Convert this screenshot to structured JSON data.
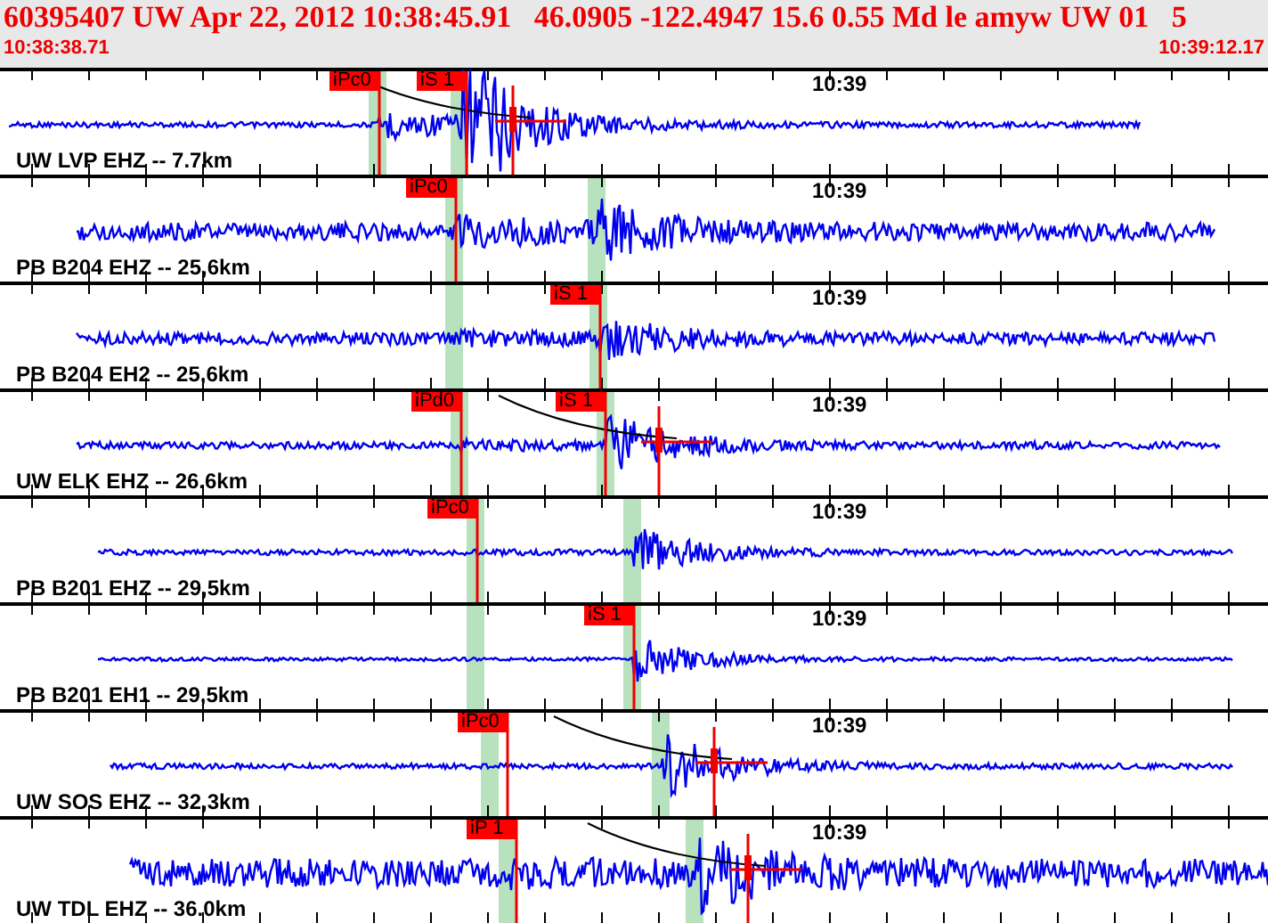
{
  "header": {
    "title": "60395407 UW Apr 22, 2012 10:38:45.91   46.0905 -122.4947 15.6 0.55 Md le amyw UW 01   5",
    "start_time": "10:38:38.71",
    "end_time": "10:39:12.17"
  },
  "traces": [
    {
      "station": "UW LVP EHZ -- 7.7km",
      "time_label": "10:39",
      "picks": [
        {
          "label": "iPc0"
        },
        {
          "label": "iS 1"
        }
      ]
    },
    {
      "station": "PB B204 EHZ -- 25,6km",
      "time_label": "10:39",
      "picks": [
        {
          "label": "iPc0"
        }
      ]
    },
    {
      "station": "PB B204 EH2 -- 25,6km",
      "time_label": "10:39",
      "picks": [
        {
          "label": "iS 1"
        }
      ]
    },
    {
      "station": "UW ELK EHZ -- 26.6km",
      "time_label": "10:39",
      "picks": [
        {
          "label": "iPd0"
        },
        {
          "label": "iS 1"
        }
      ]
    },
    {
      "station": "PB B201 EHZ -- 29,5km",
      "time_label": "10:39",
      "picks": [
        {
          "label": "iPc0"
        }
      ]
    },
    {
      "station": "PB B201 EH1 -- 29,5km",
      "time_label": "10:39",
      "picks": [
        {
          "label": "iS 1"
        }
      ]
    },
    {
      "station": "UW SOS EHZ -- 32,3km",
      "time_label": "10:39",
      "picks": [
        {
          "label": "iPc0"
        }
      ]
    },
    {
      "station": "UW TDL EHZ -- 36.0km",
      "time_label": "10:39",
      "picks": [
        {
          "label": "iP 1"
        }
      ]
    }
  ]
}
